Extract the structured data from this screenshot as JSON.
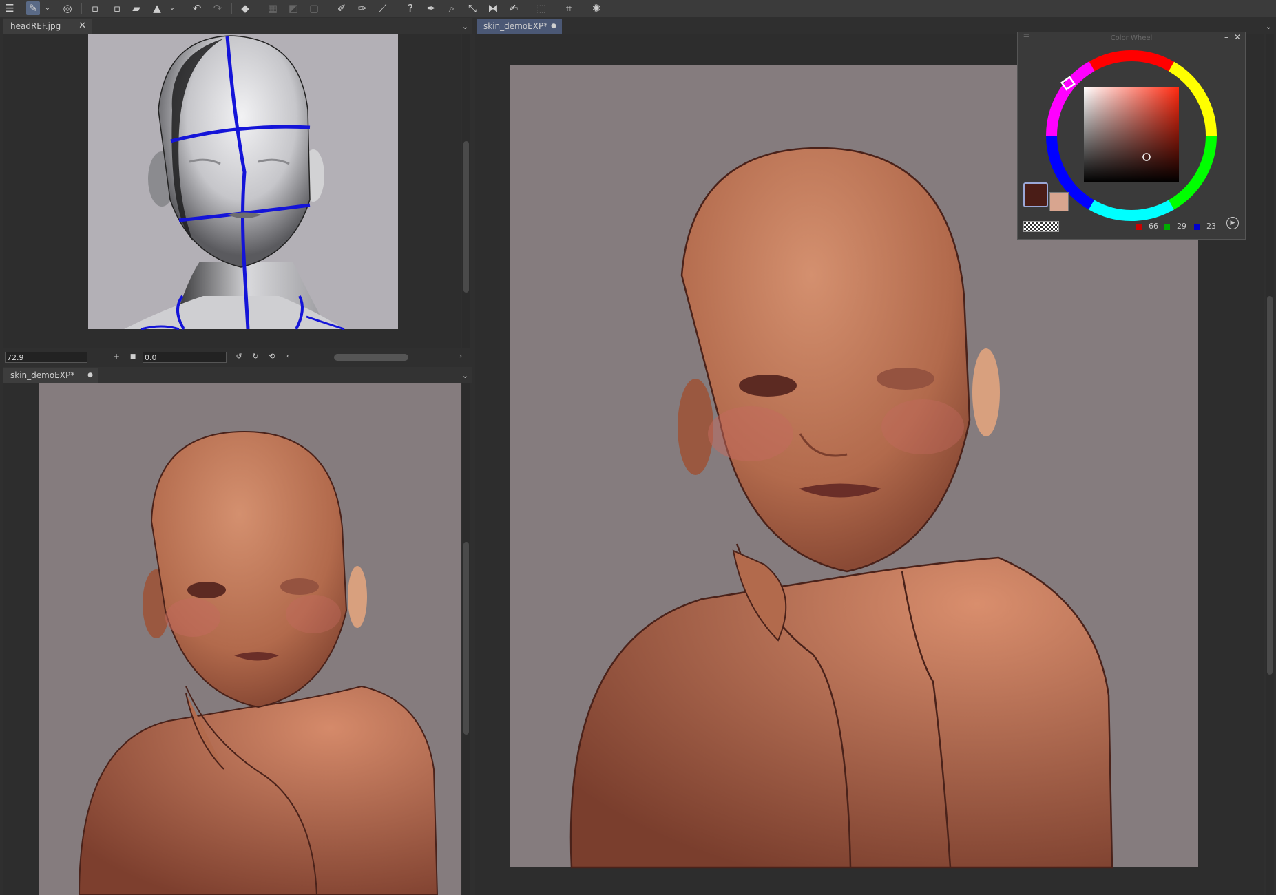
{
  "toolbar": {
    "icons": [
      "menu-icon",
      "brush-tool-icon",
      "dropdown-icon",
      "spiral-icon",
      "new-layer-icon",
      "add-layer-icon",
      "open-icon",
      "save-icon",
      "dropdown-icon",
      "undo-icon",
      "redo-icon",
      "fill-icon",
      "grid-icon",
      "gradient-icon",
      "frame-icon",
      "edit-icon",
      "erase-icon",
      "line-icon",
      "help-icon",
      "eyedropper-icon",
      "zoom-icon",
      "transform-icon",
      "mirror-icon",
      "smudge-icon",
      "select-icon",
      "crop-icon",
      "sparkle-icon"
    ]
  },
  "left_top_panel": {
    "tab_title": "headREF.jpg",
    "zoom_value": "72.9",
    "rotation_value": "0.0"
  },
  "left_bottom_panel": {
    "tab_title": "skin_demoEXP*"
  },
  "main_panel": {
    "tab_title": "skin_demoEXP*"
  },
  "color_wheel": {
    "title": "Color Wheel",
    "r": "66",
    "g": "29",
    "b": "23",
    "foreground": "#4a1d17",
    "background": "#d8a58f"
  },
  "colors": {
    "accent": "#5a6a86",
    "canvas_gray": "#857c7e",
    "skin": "#b86f52",
    "skin_shadow": "#7a3f2e"
  }
}
